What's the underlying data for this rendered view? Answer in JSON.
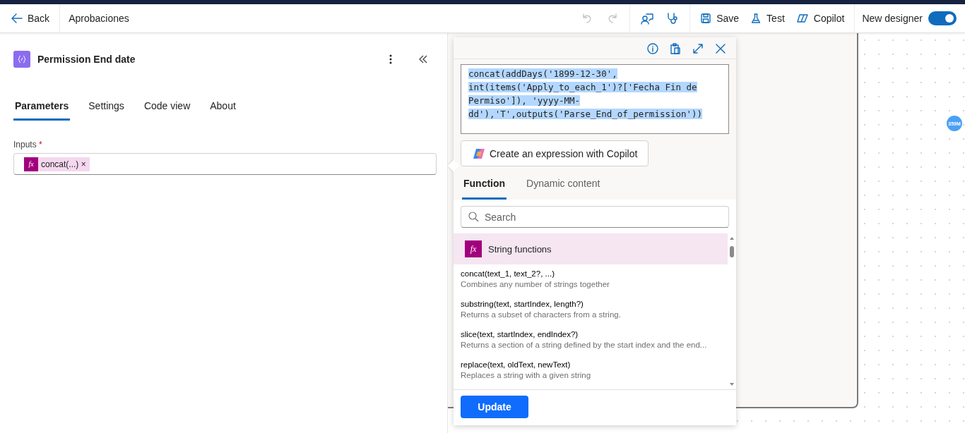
{
  "header": {
    "back": "Back",
    "title": "Aprobaciones",
    "undo_disabled": true,
    "redo_disabled": true,
    "actions": [
      {
        "kind": "save",
        "label": "Save"
      },
      {
        "kind": "test",
        "label": "Test"
      },
      {
        "kind": "copilot",
        "label": "Copilot"
      }
    ],
    "toggle": {
      "label": "New designer",
      "on": true
    }
  },
  "panel": {
    "title": "Permission End date",
    "tabs": [
      {
        "label": "Parameters",
        "selected": true
      },
      {
        "label": "Settings",
        "selected": false
      },
      {
        "label": "Code view",
        "selected": false
      },
      {
        "label": "About",
        "selected": false
      }
    ],
    "field": {
      "label": "Inputs",
      "required": "*",
      "token_icon": "fx",
      "token": "concat(...)",
      "token_remove": "×"
    }
  },
  "canvas": {
    "badge": "359M"
  },
  "expression": {
    "text": "concat(addDays('1899-12-30', int(items('Apply_to_each_1')?['Fecha Fin de Permiso']), 'yyyy-MM-dd'),'T',outputs('Parse_End_of_permission'))",
    "copilot_button": "Create an expression with Copilot",
    "tabs": [
      {
        "label": "Function",
        "selected": true
      },
      {
        "label": "Dynamic content",
        "selected": false
      }
    ],
    "search": {
      "placeholder": "Search"
    },
    "category_icon": "fx",
    "category": "String functions",
    "functions": [
      {
        "name": "concat(text_1, text_2?, ...)",
        "description": "Combines any number of strings together"
      },
      {
        "name": "substring(text, startIndex, length?)",
        "description": "Returns a subset of characters from a string."
      },
      {
        "name": "slice(text, startIndex, endIndex?)",
        "description": "Returns a section of a string defined by the start index and the end..."
      },
      {
        "name": "replace(text, oldText, newText)",
        "description": "Replaces a string with a given string"
      }
    ],
    "update_button": "Update"
  }
}
